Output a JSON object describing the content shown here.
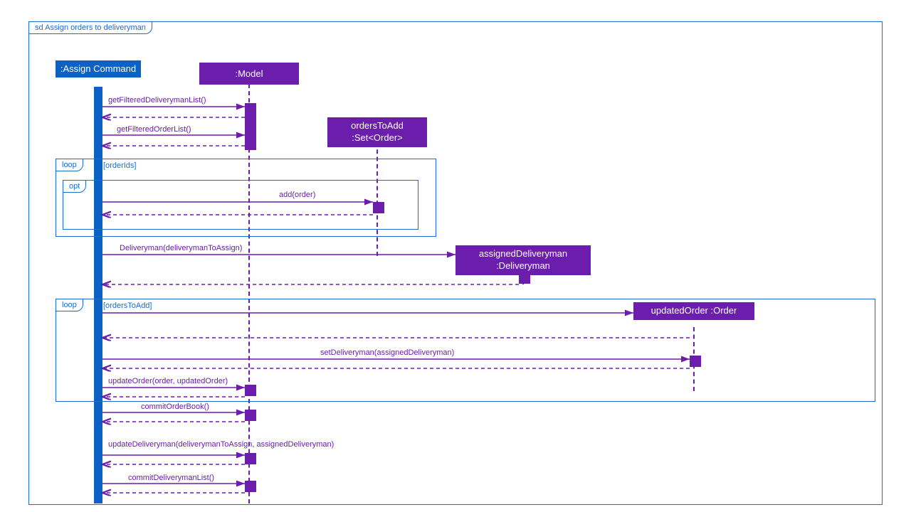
{
  "diagram": {
    "title": "sd Assign orders to deliveryman",
    "lifelines": {
      "assign": ":Assign Command",
      "model": ":Model",
      "orders": "ordersToAdd :Set<Order>",
      "deliveryman": "assignedDeliveryman :Deliveryman",
      "updated": "updatedOrder :Order"
    },
    "fragments": {
      "loop1": {
        "type": "loop",
        "guard": "[orderIds]"
      },
      "opt1": {
        "type": "opt",
        "guard": ""
      },
      "loop2": {
        "type": "loop",
        "guard": "[ordersToAdd]"
      }
    },
    "messages": {
      "m1": "getFilteredDeliverymanList()",
      "m2": "getFilteredOrderList()",
      "m3": "add(order)",
      "m4": "Deliveryman(deliverymanToAssign)",
      "m5": "setDeliveryman(assignedDeliveryman)",
      "m6": "updateOrder(order, updatedOrder)",
      "m7": "commitOrderBook()",
      "m8": "updateDeliveryman(deliverymanToAssign,  assignedDeliveryman)",
      "m9": "commitDeliverymanList()"
    }
  },
  "colors": {
    "blue": "#0b62c4",
    "purple": "#6b1dab",
    "frame": "#1a6dcc"
  }
}
